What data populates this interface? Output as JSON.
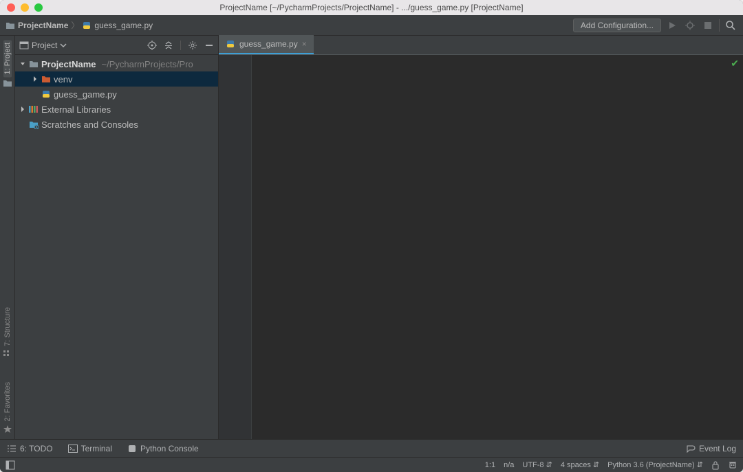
{
  "title": "ProjectName [~/PycharmProjects/ProjectName] - .../guess_game.py [ProjectName]",
  "breadcrumb": {
    "project": "ProjectName",
    "file": "guess_game.py"
  },
  "toolbar": {
    "add_config": "Add Configuration..."
  },
  "gutter": {
    "project": "1: Project",
    "structure": "7: Structure",
    "favorites": "2: Favorites"
  },
  "sidebar": {
    "view_label": "Project",
    "tree": {
      "root": "ProjectName",
      "root_path": "~/PycharmProjects/Pro",
      "venv": "venv",
      "file": "guess_game.py",
      "ext_lib": "External Libraries",
      "scratches": "Scratches and Consoles"
    }
  },
  "tabs": {
    "active": "guess_game.py"
  },
  "bottom": {
    "todo": "6: TODO",
    "terminal": "Terminal",
    "python_console": "Python Console",
    "event_log": "Event Log"
  },
  "status": {
    "pos": "1:1",
    "lineend": "n/a",
    "encoding": "UTF-8",
    "indent": "4 spaces",
    "interpreter": "Python 3.6 (ProjectName)"
  }
}
